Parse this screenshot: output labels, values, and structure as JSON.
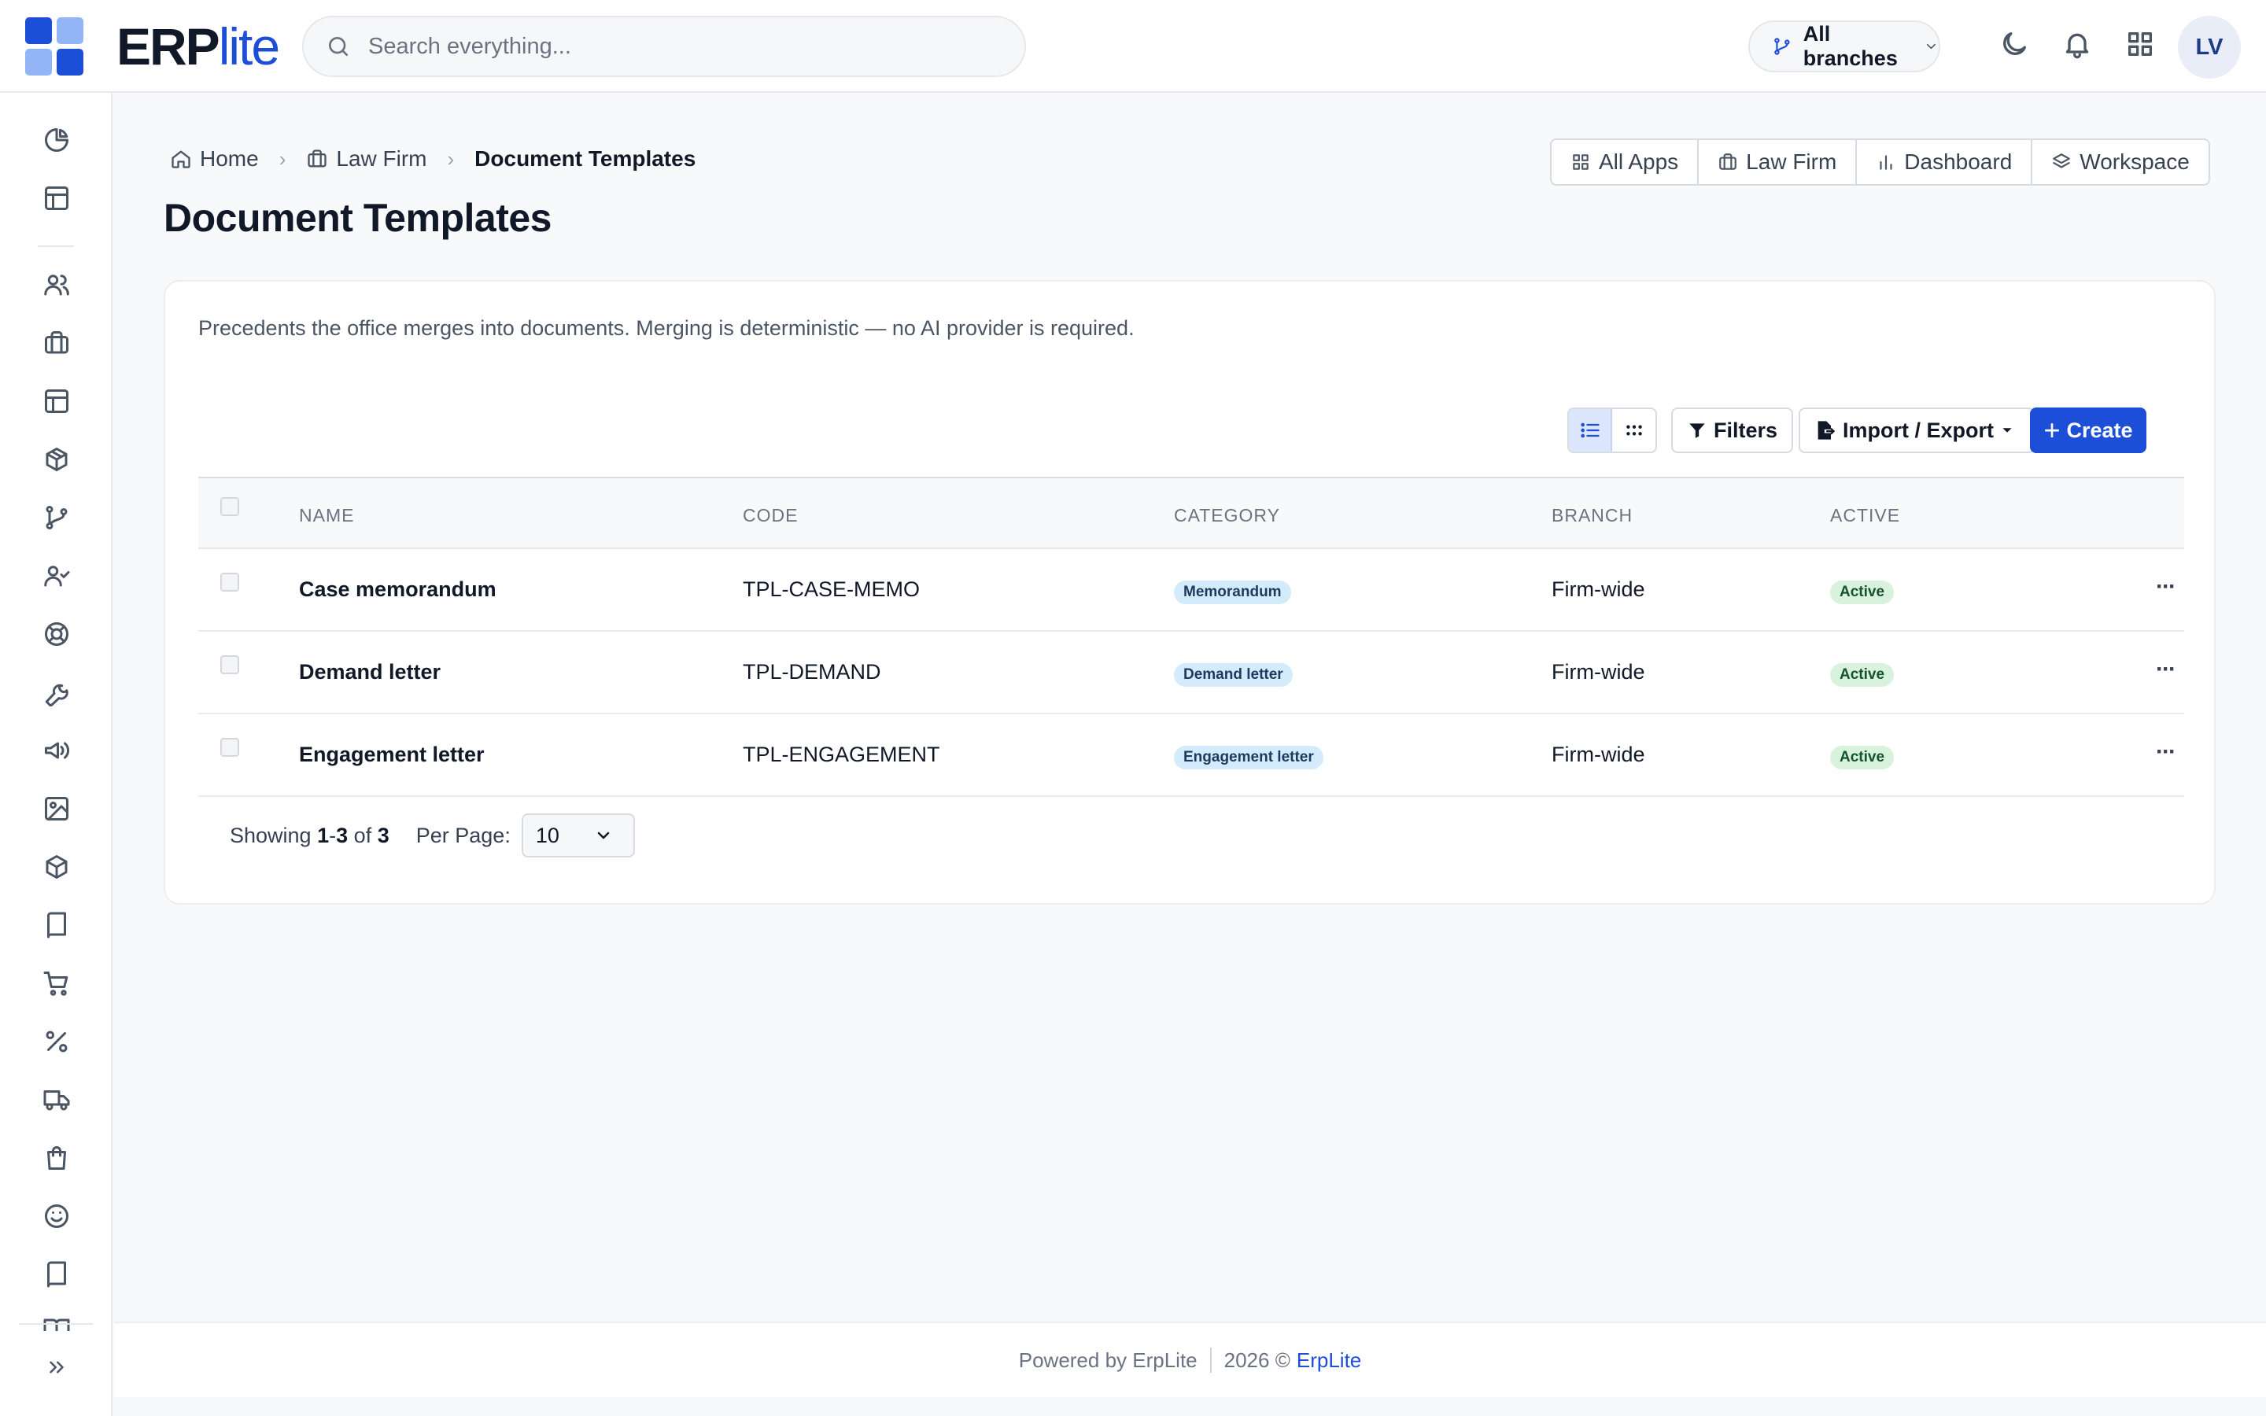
{
  "app": {
    "logo_bold": "ERP",
    "logo_light": "lite",
    "brand_color": "#1d4ed8"
  },
  "header": {
    "search_placeholder": "Search everything...",
    "branch_label": "All branches",
    "avatar_initials": "LV"
  },
  "sidebar": {
    "icons": [
      "pie-chart-icon",
      "layout-icon",
      "users-icon",
      "briefcase-icon",
      "layout-icon",
      "package-icon",
      "git-branch-icon",
      "user-check-icon",
      "life-buoy-icon",
      "wrench-icon",
      "megaphone-icon",
      "image-icon",
      "box-icon",
      "book-icon",
      "cart-icon",
      "percent-icon",
      "truck-icon",
      "shopping-bag-icon",
      "smile-icon",
      "book-icon",
      "book-open-icon"
    ],
    "collapse_icon": "chevrons-right-icon"
  },
  "breadcrumb": {
    "home": "Home",
    "section": "Law Firm",
    "current": "Document Templates"
  },
  "quick_links": [
    {
      "label": "All Apps",
      "icon": "grid-icon"
    },
    {
      "label": "Law Firm",
      "icon": "briefcase-icon"
    },
    {
      "label": "Dashboard",
      "icon": "bar-chart-icon"
    },
    {
      "label": "Workspace",
      "icon": "layers-icon"
    }
  ],
  "page": {
    "title": "Document Templates",
    "description": "Precedents the office merges into documents. Merging is deterministic — no AI provider is required."
  },
  "toolbar": {
    "filters_label": "Filters",
    "import_export_label": "Import / Export",
    "create_label": "Create",
    "view_mode": "list"
  },
  "table": {
    "columns": [
      "NAME",
      "CODE",
      "CATEGORY",
      "BRANCH",
      "ACTIVE"
    ],
    "rows": [
      {
        "name": "Case memorandum",
        "code": "TPL-CASE-MEMO",
        "category": "Memorandum",
        "branch": "Firm-wide",
        "active": "Active"
      },
      {
        "name": "Demand letter",
        "code": "TPL-DEMAND",
        "category": "Demand letter",
        "branch": "Firm-wide",
        "active": "Active"
      },
      {
        "name": "Engagement letter",
        "code": "TPL-ENGAGEMENT",
        "category": "Engagement letter",
        "branch": "Firm-wide",
        "active": "Active"
      }
    ]
  },
  "pagination": {
    "showing_prefix": "Showing",
    "range_start": "1",
    "range_dash": "-",
    "range_end": "3",
    "of_label": "of",
    "total": "3",
    "per_page_label": "Per Page:",
    "per_page_value": "10"
  },
  "footer": {
    "powered_by": "Powered by ErpLite",
    "copyright": "2026 ©",
    "brand_link": "ErpLite"
  }
}
